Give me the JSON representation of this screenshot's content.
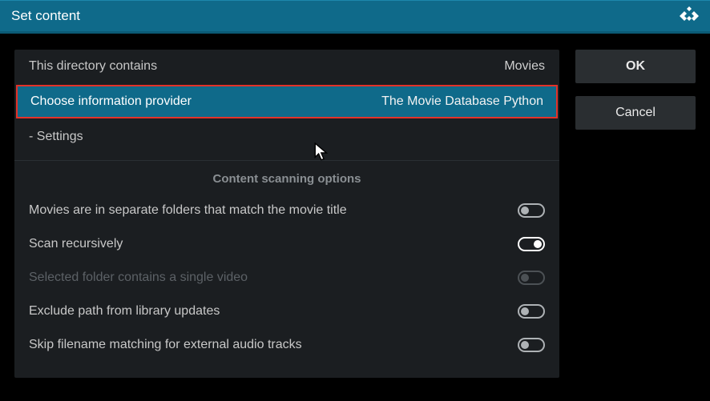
{
  "titlebar": {
    "title": "Set content"
  },
  "main": {
    "row_directory": {
      "label": "This directory contains",
      "value": "Movies"
    },
    "row_provider": {
      "label": "Choose information provider",
      "value": "The Movie Database Python"
    },
    "row_settings": {
      "label": "- Settings"
    },
    "section_header": "Content scanning options",
    "opt_separate": {
      "label": "Movies are in separate folders that match the movie title",
      "on": false
    },
    "opt_recursive": {
      "label": "Scan recursively",
      "on": true
    },
    "opt_single": {
      "label": "Selected folder contains a single video",
      "on": false,
      "disabled": true
    },
    "opt_exclude": {
      "label": "Exclude path from library updates",
      "on": false
    },
    "opt_skipaudio": {
      "label": "Skip filename matching for external audio tracks",
      "on": false
    }
  },
  "buttons": {
    "ok": "OK",
    "cancel": "Cancel"
  }
}
